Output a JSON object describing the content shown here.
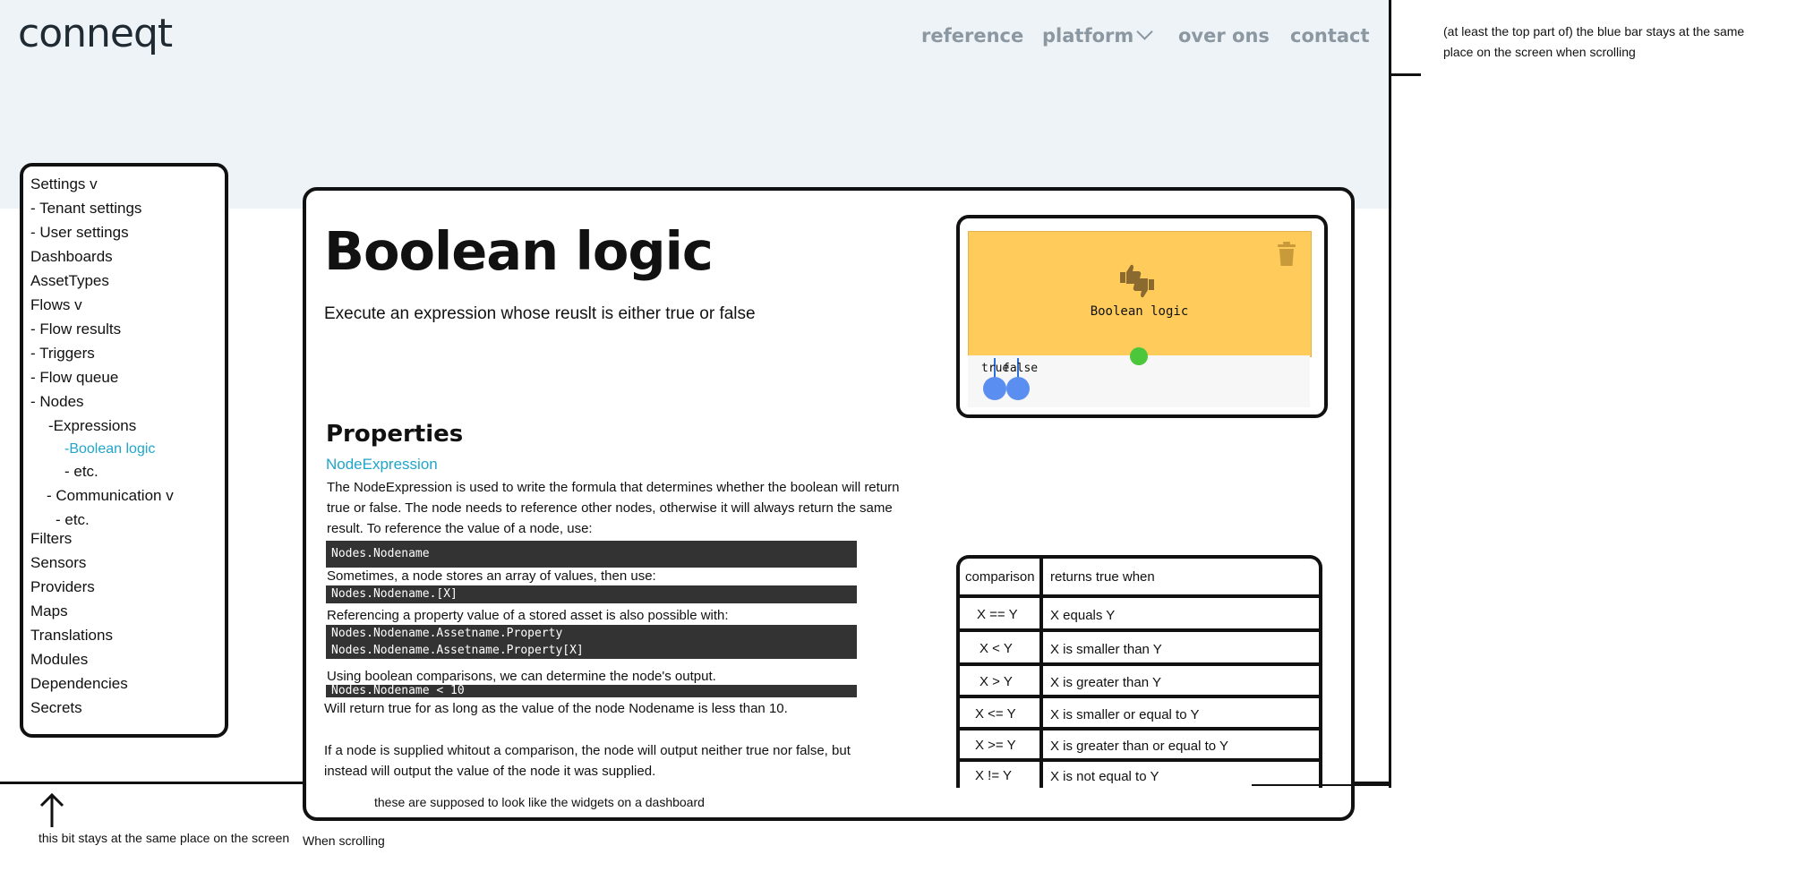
{
  "header": {
    "logo": "conneqt",
    "nav": {
      "reference": "reference",
      "platform": "platform",
      "over_ons": "over ons",
      "contact": "contact"
    }
  },
  "sidebar": {
    "items": [
      "Settings v",
      " - Tenant settings",
      " - User settings",
      "Dashboards",
      "AssetTypes",
      "Flows v",
      "- Flow results",
      "- Triggers",
      "- Flow queue",
      "- Nodes",
      "-Expressions",
      "-Boolean logic",
      "- etc.",
      "- Communication v",
      "- etc.",
      "Filters",
      "Sensors",
      "Providers",
      "Maps",
      "Translations",
      "Modules",
      "Dependencies",
      "Secrets"
    ],
    "active_index": 11
  },
  "main": {
    "title": "Boolean logic",
    "subtitle": "Execute an expression whose reuslt is either true or false",
    "properties_heading": "Properties",
    "property_name": "NodeExpression",
    "para1": "The NodeExpression is used to write the formula that determines whether the boolean will return true or false. The node needs to reference other nodes, otherwise it will always return the same result. To reference the value of a node, use:",
    "code1": "Nodes.Nodename",
    "para2": "Sometimes, a node stores an array of values, then use:",
    "code2": "Nodes.Nodename.[X]",
    "para3": "Referencing a property value of a stored asset is also possible with:",
    "code3a": "Nodes.Nodename.Assetname.Property",
    "code3b": "Nodes.Nodename.Assetname.Property[X]",
    "para4": "Using boolean comparisons, we can determine the node's output.",
    "code4": "Nodes.Nodename < 10",
    "para5": "Will return true for as long as the value of the node Nodename is less than 10.",
    "para6": "If a node is supplied whitout a comparison, the node will output neither true nor false, but instead will output the value of the node it was supplied."
  },
  "widget": {
    "node_label": "Boolean logic",
    "output_true": "true",
    "output_false": "false",
    "card_color": "#ffcc5c",
    "input_color": "#4cc63a",
    "output_color": "#5a8ef0"
  },
  "comparison_table": {
    "headers": [
      "comparison",
      "returns true when"
    ],
    "rows": [
      [
        "X == Y",
        "X equals Y"
      ],
      [
        "X < Y",
        "X is smaller than Y"
      ],
      [
        "X > Y",
        "X is greater than Y"
      ],
      [
        "X <= Y",
        "X is smaller or equal to Y"
      ],
      [
        "X >= Y",
        "X is greater than or equal to Y"
      ],
      [
        "X != Y",
        "X is not equal to Y"
      ]
    ]
  },
  "annotations": {
    "right_note": "(at least the top part of) the blue bar stays at the same place on the screen when scrolling",
    "widgets_note": "these are supposed to look like the widgets on a dashboard",
    "bottom_note_a": "this bit stays at the same place on the screen",
    "bottom_note_b": "When scrolling"
  },
  "colors": {
    "link_accent": "#1fa6c9",
    "nav_text": "#8b97a1",
    "header_bg": "#eef3f7",
    "code_bg": "#333333"
  }
}
